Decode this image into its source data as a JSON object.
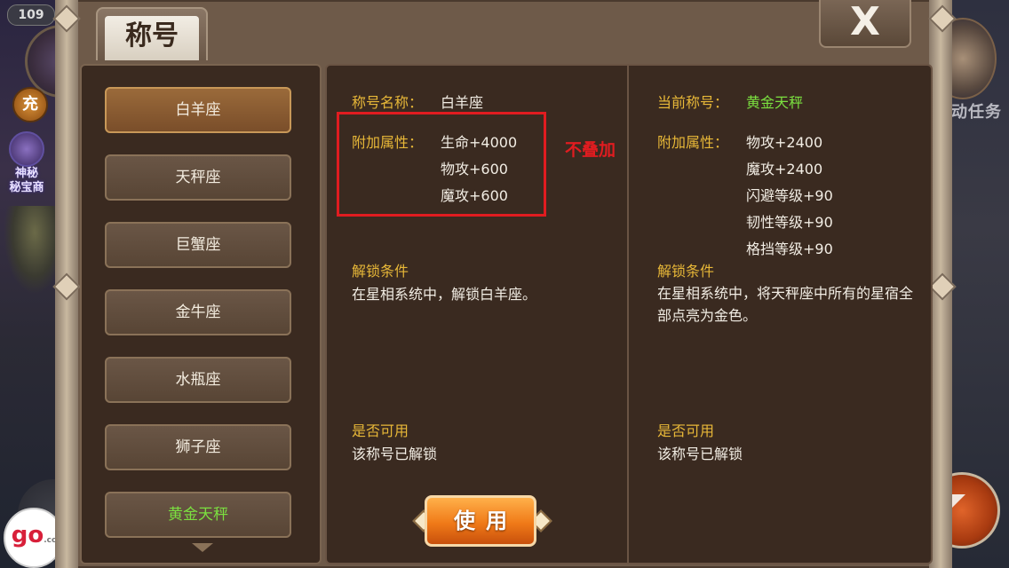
{
  "hud": {
    "level": "109",
    "recharge_label": "充",
    "mystery_shop_label_1": "神秘",
    "mystery_shop_label_2": "秘宝商",
    "auto_task_label": "动任务",
    "logo_text": "go",
    "logo_sub": ".cc"
  },
  "dialog": {
    "tab_title": "称号",
    "close_label": "X"
  },
  "title_list": [
    {
      "label": "白羊座",
      "selected": true
    },
    {
      "label": "天秤座"
    },
    {
      "label": "巨蟹座"
    },
    {
      "label": "金牛座"
    },
    {
      "label": "水瓶座"
    },
    {
      "label": "狮子座"
    },
    {
      "label": "黄金天秤",
      "color": "#7be040"
    }
  ],
  "selected_title": {
    "name_label": "称号名称：",
    "name_value": "白羊座",
    "attr_label": "附加属性：",
    "attrs": [
      "生命+4000",
      "物攻+600",
      "魔攻+600"
    ],
    "unlock_label": "解锁条件",
    "unlock_text": "在星相系统中，解锁白羊座。",
    "available_label": "是否可用",
    "available_text": "该称号已解锁"
  },
  "current_title": {
    "name_label": "当前称号：",
    "name_value": "黄金天秤",
    "attr_label": "附加属性：",
    "attrs": [
      "物攻+2400",
      "魔攻+2400",
      "闪避等级+90",
      "韧性等级+90",
      "格挡等级+90"
    ],
    "unlock_label": "解锁条件",
    "unlock_text": "在星相系统中，将天秤座中所有的星宿全部点亮为金色。",
    "available_label": "是否可用",
    "available_text": "该称号已解锁"
  },
  "annotation": {
    "text": "不叠加",
    "color": "#e01c20"
  },
  "use_button_label": "使用",
  "colors": {
    "gold": "#e8b838",
    "lime": "#7be040",
    "accent_orange": "#f07a18"
  }
}
